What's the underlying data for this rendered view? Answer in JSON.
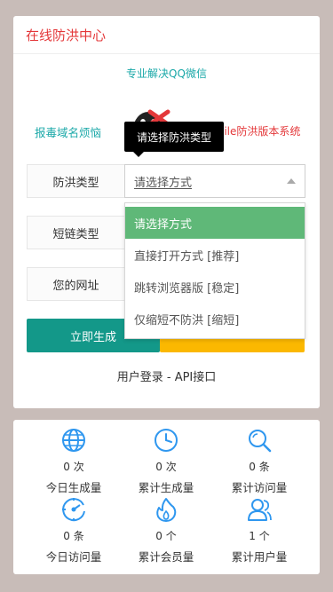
{
  "header": {
    "title": "在线防洪中心"
  },
  "promo": {
    "subtitle": "专业解决QQ微信",
    "left_text": "报毒域名烦恼",
    "right_text": "Mobile防洪版本系统"
  },
  "tooltip": {
    "text": "请选择防洪类型"
  },
  "form": {
    "type_label": "防洪类型",
    "type_value": "请选择方式",
    "short_label": "短链类型",
    "url_label": "您的网址"
  },
  "dropdown": {
    "options": [
      "请选择方式",
      "直接打开方式 [推荐]",
      "跳转浏览器版 [稳定]",
      "仅缩短不防洪 [缩短]"
    ],
    "selected_index": 0
  },
  "buttons": {
    "generate": "立即生成",
    "second": ""
  },
  "links": {
    "login": "用户登录",
    "separator": " - ",
    "api": "API接口"
  },
  "stats": [
    {
      "icon": "globe-icon",
      "value": "0 次",
      "label": "今日生成量"
    },
    {
      "icon": "clock-icon",
      "value": "0 次",
      "label": "累计生成量"
    },
    {
      "icon": "search-icon",
      "value": "0 条",
      "label": "累计访问量"
    },
    {
      "icon": "dial-icon",
      "value": "0 条",
      "label": "今日访问量"
    },
    {
      "icon": "flame-icon",
      "value": "0 个",
      "label": "累计会员量"
    },
    {
      "icon": "users-icon",
      "value": "1 个",
      "label": "累计用户量"
    }
  ],
  "colors": {
    "accent_red": "#e4383a",
    "accent_teal": "#1aa8a8",
    "button_green": "#139889",
    "button_yellow": "#fbb800",
    "selected_green": "#5fb878",
    "icon_blue": "#2f97ef"
  }
}
